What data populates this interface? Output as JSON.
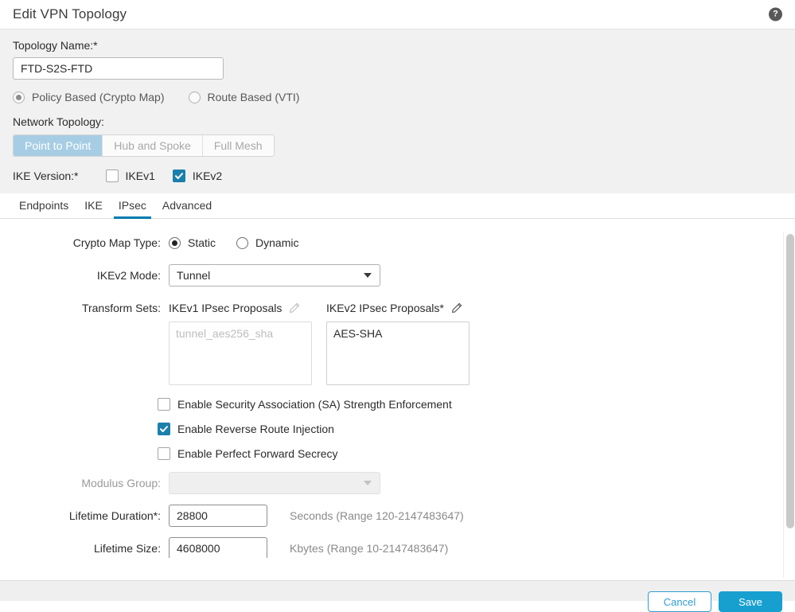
{
  "header": {
    "title": "Edit VPN Topology",
    "help_icon": "help-circle-icon",
    "help_glyph": "?"
  },
  "topology": {
    "name_label": "Topology Name:*",
    "name_value": "FTD-S2S-FTD",
    "name_placeholder": "",
    "type_options": [
      {
        "label": "Policy Based (Crypto Map)",
        "selected": true
      },
      {
        "label": "Route Based (VTI)",
        "selected": false
      }
    ],
    "network_topology_label": "Network Topology:",
    "network_topology_options": [
      {
        "label": "Point to Point",
        "active": true
      },
      {
        "label": "Hub and Spoke",
        "active": false
      },
      {
        "label": "Full Mesh",
        "active": false
      }
    ],
    "ike_version_label": "IKE Version:*",
    "ike_versions": [
      {
        "label": "IKEv1",
        "checked": false
      },
      {
        "label": "IKEv2",
        "checked": true
      }
    ]
  },
  "tabs": [
    {
      "label": "Endpoints",
      "active": false
    },
    {
      "label": "IKE",
      "active": false
    },
    {
      "label": "IPsec",
      "active": true
    },
    {
      "label": "Advanced",
      "active": false
    }
  ],
  "ipsec": {
    "crypto_map_type_label": "Crypto Map Type:",
    "crypto_map_options": [
      {
        "label": "Static",
        "selected": true
      },
      {
        "label": "Dynamic",
        "selected": false
      }
    ],
    "ikev2_mode_label": "IKEv2 Mode:",
    "ikev2_mode_value": "Tunnel",
    "transform_sets_label": "Transform Sets:",
    "ikev1_proposals_label": "IKEv1 IPsec Proposals",
    "ikev1_proposals_value": "tunnel_aes256_sha",
    "ikev2_proposals_label": "IKEv2 IPsec Proposals*",
    "ikev2_proposals_value": "AES-SHA",
    "edit_icon": "pencil-icon",
    "checkboxes": [
      {
        "label": "Enable Security Association (SA) Strength Enforcement",
        "checked": false
      },
      {
        "label": "Enable Reverse Route Injection",
        "checked": true
      },
      {
        "label": "Enable Perfect Forward Secrecy",
        "checked": false
      }
    ],
    "modulus_group_label": "Modulus Group:",
    "modulus_group_value": "",
    "lifetime_duration_label": "Lifetime Duration*:",
    "lifetime_duration_value": "28800",
    "lifetime_duration_unit": "Seconds (Range 120-2147483647)",
    "lifetime_size_label": "Lifetime Size:",
    "lifetime_size_value": "4608000",
    "lifetime_size_unit": "Kbytes (Range 10-2147483647)"
  },
  "footer": {
    "cancel_label": "Cancel",
    "save_label": "Save"
  },
  "colors": {
    "accent_blue": "#007cb0",
    "checkbox_blue": "#1a7fab",
    "segment_active": "#a7cde4",
    "save_button": "#17a0cf"
  }
}
